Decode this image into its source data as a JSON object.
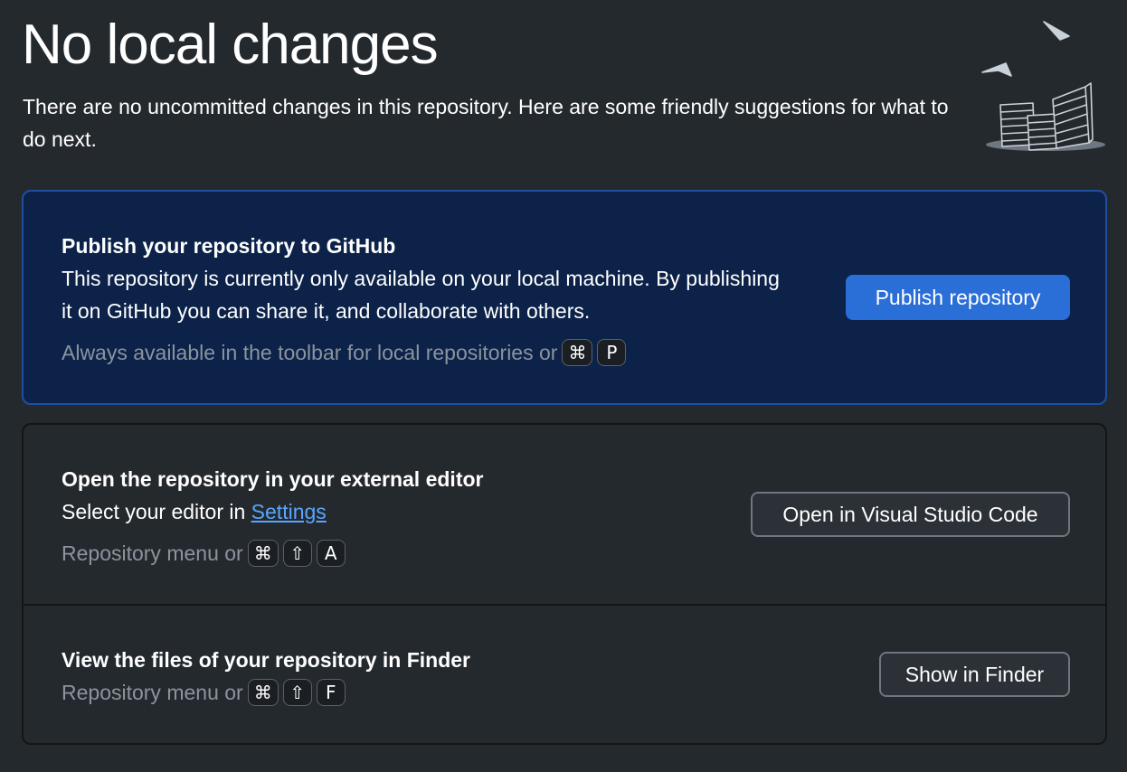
{
  "header": {
    "title": "No local changes",
    "subtitle": "There are no uncommitted changes in this repository. Here are some friendly suggestions for what to do next."
  },
  "publish": {
    "title": "Publish your repository to GitHub",
    "description": "This repository is currently only available on your local machine. By publishing it on GitHub you can share it, and collaborate with others.",
    "hint": "Always available in the toolbar for local repositories or",
    "keys": [
      "⌘",
      "P"
    ],
    "button_label": "Publish repository"
  },
  "editor": {
    "title": "Open the repository in your external editor",
    "description_prefix": "Select your editor in",
    "settings_link": "Settings",
    "hint": "Repository menu or",
    "keys": [
      "⌘",
      "⇧",
      "A"
    ],
    "button_label": "Open in Visual Studio Code"
  },
  "finder": {
    "title": "View the files of your repository in Finder",
    "hint": "Repository menu or",
    "keys": [
      "⌘",
      "⇧",
      "F"
    ],
    "button_label": "Show in Finder"
  },
  "colors": {
    "background": "#24292e",
    "publish_card": "#0c2249",
    "primary_button": "#2a6ed8",
    "link": "#58a6ff",
    "hint_text": "#8b949e"
  },
  "icons": {
    "illustration": "paper-stacks-illustration",
    "command_key": "command-key-icon",
    "shift_key": "shift-key-icon"
  }
}
